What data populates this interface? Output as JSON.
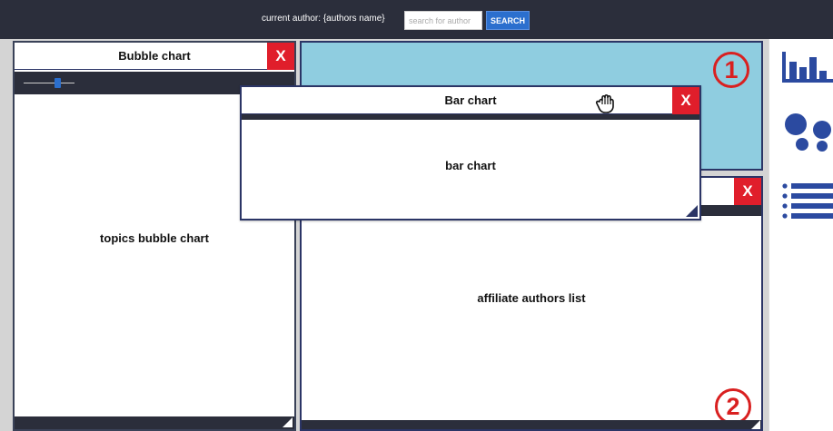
{
  "topbar": {
    "current_author_label": "current author: {authors name}",
    "search_placeholder": "search for author",
    "search_button_label": "SEARCH"
  },
  "bubble_window": {
    "title": "Bubble chart",
    "close_label": "X",
    "body_label": "topics bubble chart"
  },
  "bar_window": {
    "title": "Bar chart",
    "close_label": "X",
    "body_label": "bar chart"
  },
  "affiliate_window": {
    "close_label": "X",
    "body_label": "affiliate authors list"
  },
  "markers": {
    "one": "1",
    "two": "2"
  },
  "sidebar": {
    "icons": [
      "bar-chart-icon",
      "bubble-chart-icon",
      "list-icon"
    ]
  },
  "colors": {
    "topbar": "#2b2e3b",
    "accent": "#2b6fce",
    "close": "#e01e2b",
    "cyan_panel": "#8fcde0",
    "window_border": "#2b3566",
    "icon": "#2b4aa0",
    "marker": "#d92020"
  }
}
